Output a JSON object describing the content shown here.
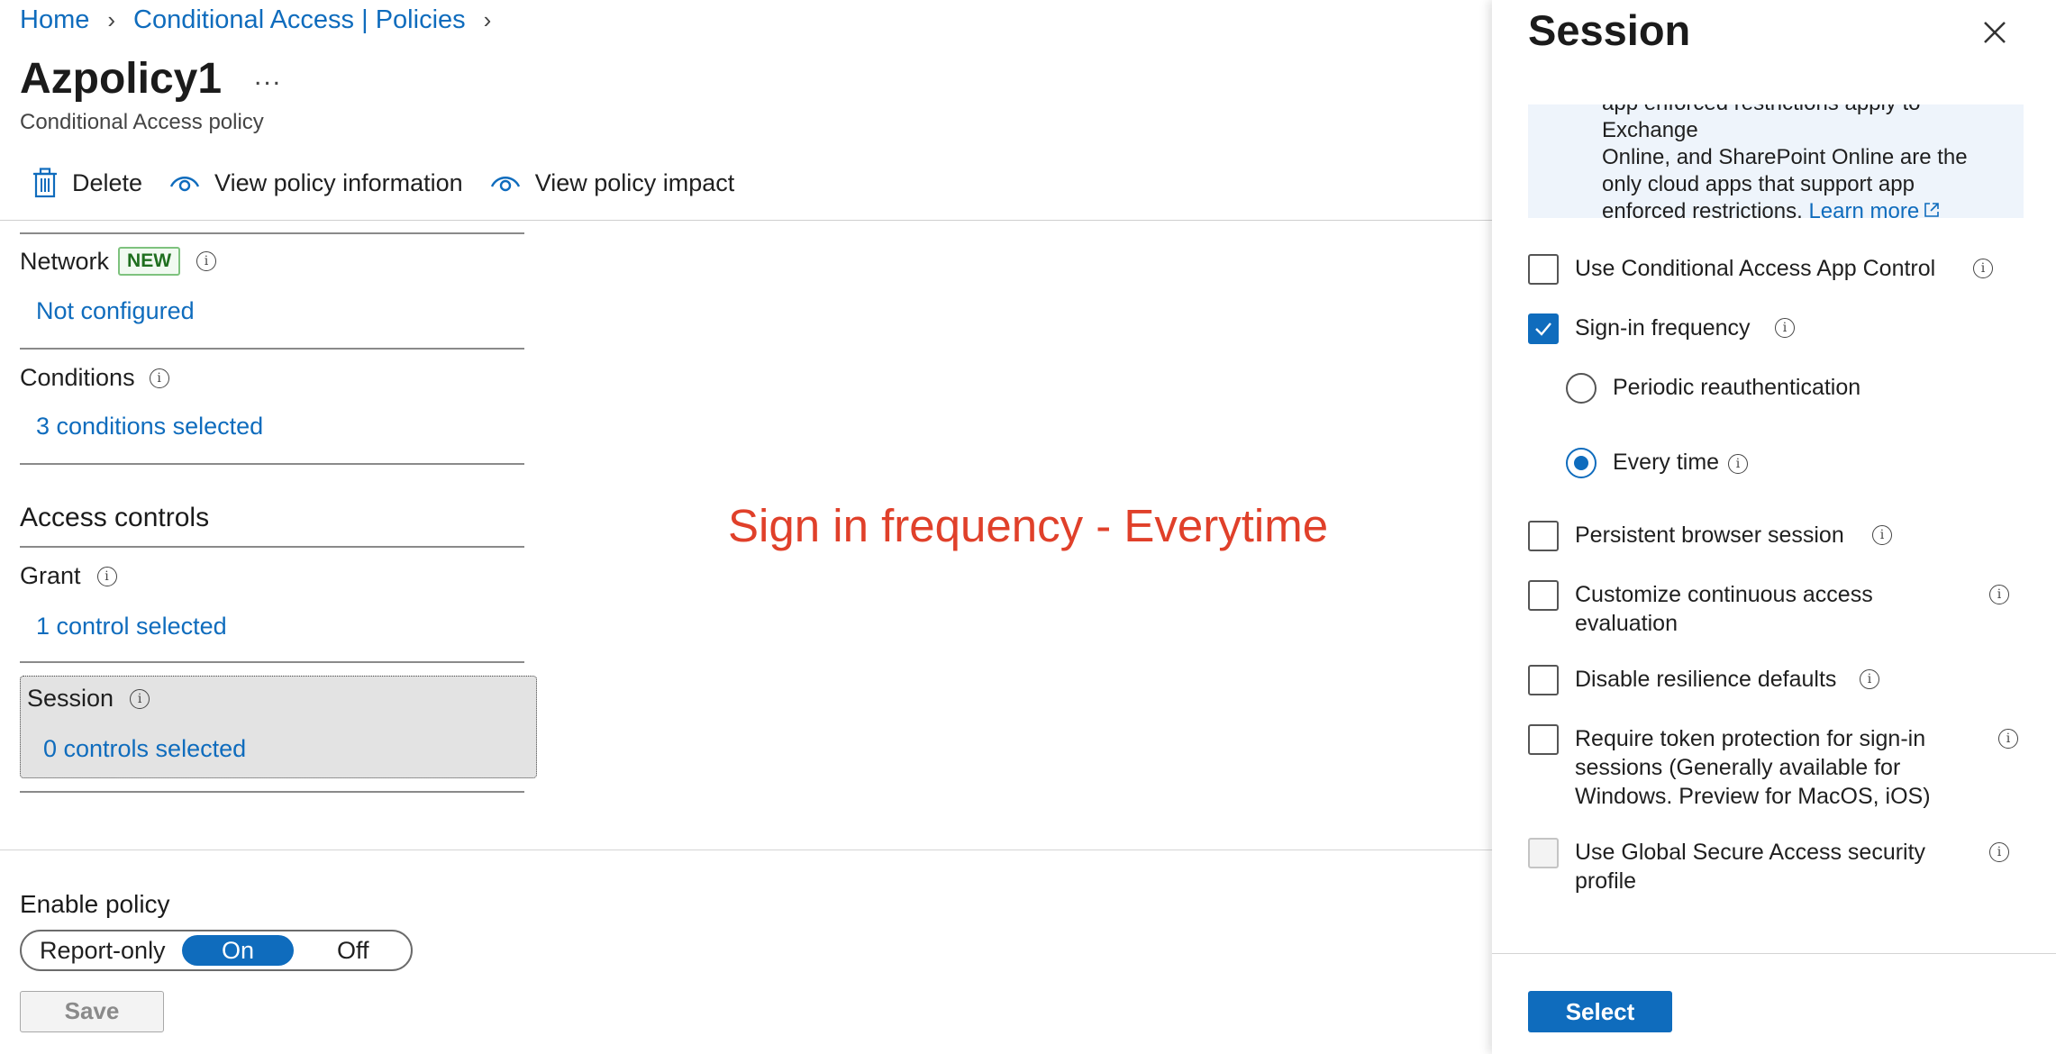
{
  "breadcrumb": {
    "home": "Home",
    "policies": "Conditional Access | Policies",
    "separator": ">"
  },
  "page": {
    "title": "Azpolicy1",
    "more": "...",
    "subtitle": "Conditional Access policy"
  },
  "toolbar": {
    "delete": "Delete",
    "view_info": "View policy information",
    "view_impact": "View policy impact"
  },
  "sections": {
    "network": {
      "label": "Network",
      "badge": "NEW",
      "value": "Not configured"
    },
    "conditions": {
      "label": "Conditions",
      "value": "3 conditions selected"
    },
    "access_controls": "Access controls",
    "grant": {
      "label": "Grant",
      "value": "1 control selected"
    },
    "session": {
      "label": "Session",
      "value": "0 controls selected"
    }
  },
  "annotation": "Sign in frequency - Everytime",
  "enable_policy": {
    "label": "Enable policy",
    "options": [
      "Report-only",
      "On",
      "Off"
    ],
    "selected": "On"
  },
  "save_label": "Save",
  "panel": {
    "title": "Session",
    "info_text": "Exchange Online, and SharePoint Online are the only cloud apps that support app enforced restrictions.",
    "info_lines": [
      "Online, and SharePoint Online are the",
      "only cloud apps that support app",
      "enforced restrictions."
    ],
    "info_top_line": "app enforced restrictions apply to Exchange",
    "learn_more": "Learn more",
    "options": {
      "app_control": {
        "label": "Use Conditional Access App Control",
        "checked": false
      },
      "signin_freq": {
        "label": "Sign-in frequency",
        "checked": true
      },
      "periodic": {
        "label": "Periodic reauthentication",
        "selected": false
      },
      "every_time": {
        "label": "Every time",
        "selected": true
      },
      "persistent": {
        "label": "Persistent browser session",
        "checked": false
      },
      "cae": {
        "label_1": "Customize continuous access",
        "label_2": "evaluation",
        "checked": false
      },
      "resilience": {
        "label": "Disable resilience defaults",
        "checked": false
      },
      "token": {
        "label_1": "Require token protection for sign-in",
        "label_2": "sessions (Generally available for",
        "label_3": "Windows. Preview for MacOS, iOS)",
        "checked": false
      },
      "gsa": {
        "label_1": "Use Global Secure Access security",
        "label_2": "profile",
        "checked": false,
        "disabled": true
      }
    },
    "select_label": "Select"
  },
  "colors": {
    "accent": "#0f6cbd",
    "annotation": "#e0402a",
    "badge_green": "#1f6f1f"
  }
}
